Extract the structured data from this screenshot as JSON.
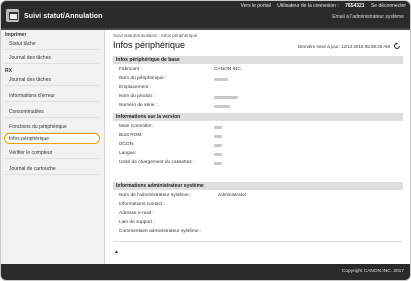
{
  "header": {
    "title": "Suivi statut/Annulation",
    "top_links": {
      "portal": "Vers le portail",
      "user_label": "Utilisateur de la connexion :",
      "user_value": "7654321",
      "logout": "Se déconnecter"
    },
    "admin_mail": "Email à l'administrateur système"
  },
  "sidebar": {
    "sections": [
      {
        "label": "Imprimer"
      },
      {
        "label": "RX"
      }
    ],
    "items": [
      {
        "label": "Statut tâche"
      },
      {
        "label": "Journal des tâches"
      },
      {
        "label": "Journal des tâches"
      },
      {
        "label": "Informations d'erreur"
      },
      {
        "label": "Consommables"
      },
      {
        "label": "Fonctions du périphérique"
      },
      {
        "label": "Infos périphérique"
      },
      {
        "label": "Vérifier le compteur"
      },
      {
        "label": "Journal de cartouche"
      }
    ]
  },
  "main": {
    "breadcrumb": "Suivi statut/Annulation : Infos périphérique",
    "title": "Infos périphérique",
    "last_update": "Dernière mise à jour: 12/12 2016 05:59:25 AM",
    "sections": [
      {
        "title": "Infos périphérique de base",
        "rows": [
          {
            "label": "Fabricant :",
            "value": "CANON INC."
          },
          {
            "label": "Nom du périphérique :",
            "value": ""
          },
          {
            "label": "Emplacement :",
            "value": ""
          },
          {
            "label": "Nom du produit :",
            "value": ""
          },
          {
            "label": "Numéro de série :",
            "value": ""
          }
        ]
      },
      {
        "title": "Informations sur la version",
        "rows": [
          {
            "label": "Main Controller:",
            "value": ""
          },
          {
            "label": "Boot ROM:",
            "value": ""
          },
          {
            "label": "DCON:",
            "value": ""
          },
          {
            "label": "Langue:",
            "value": ""
          },
          {
            "label": "Unité de chargement du cassettes :",
            "value": ""
          }
        ]
      },
      {
        "title": "Informations administrateur système",
        "rows": [
          {
            "label": "Nom de l'administrateur système :",
            "value": "Administrator"
          },
          {
            "label": "Informations contact :",
            "value": ""
          },
          {
            "label": "Adresse e-mail :",
            "value": ""
          },
          {
            "label": "Lien de support :",
            "value": ""
          },
          {
            "label": "Commentaire administrateur système :",
            "value": ""
          }
        ]
      }
    ],
    "to_top": "▲"
  },
  "footer": {
    "copyright": "Copyright CANON INC. 2017"
  },
  "icons": {
    "refresh": "refresh-icon",
    "logo": "printer-logo-icon"
  },
  "colors": {
    "header_bg": "#2a2a2a",
    "active_border": "#f0a100",
    "section_bg": "#dedede"
  }
}
